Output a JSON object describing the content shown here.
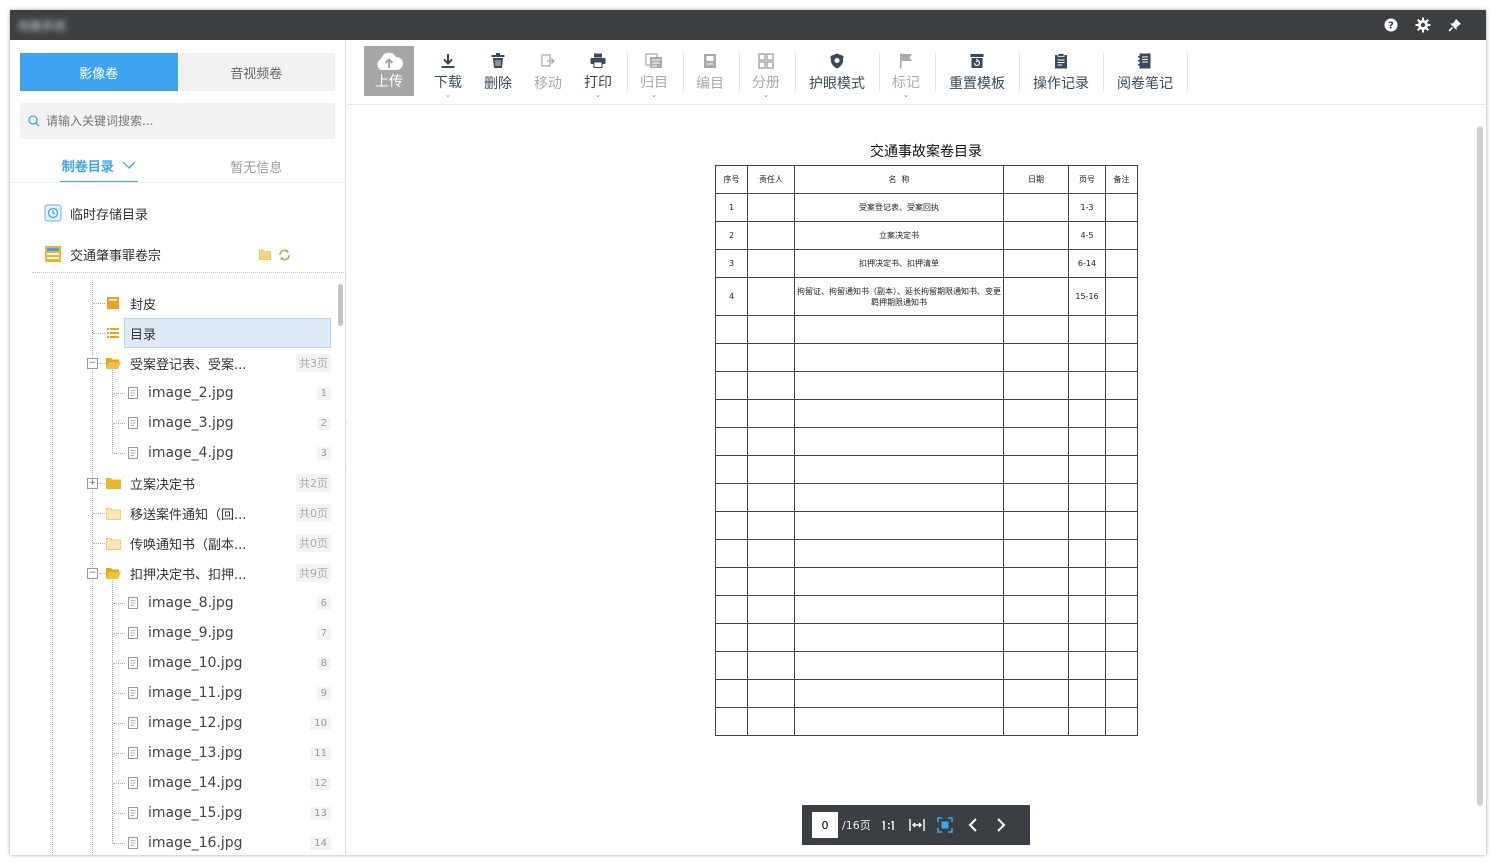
{
  "window": {
    "title": "档案系统"
  },
  "sidebar": {
    "tabs": [
      {
        "label": "影像卷"
      },
      {
        "label": "音视频卷"
      }
    ],
    "search": {
      "placeholder": "请输入关键词搜索..."
    },
    "subtabs": [
      {
        "label": "制卷目录"
      },
      {
        "label": "暂无信息"
      }
    ],
    "root_items": [
      {
        "label": "临时存储目录"
      },
      {
        "label": "交通肇事罪卷宗"
      }
    ],
    "tree": [
      {
        "label": "封皮"
      },
      {
        "label": "目录"
      },
      {
        "label": "受案登记表、受案...",
        "count": "共3页"
      },
      {
        "label": "image_2.jpg",
        "num": "1"
      },
      {
        "label": "image_3.jpg",
        "num": "2"
      },
      {
        "label": "image_4.jpg",
        "num": "3"
      },
      {
        "label": "立案决定书",
        "count": "共2页"
      },
      {
        "label": "移送案件通知（回...",
        "count": "共0页"
      },
      {
        "label": "传唤通知书（副本...",
        "count": "共0页"
      },
      {
        "label": "扣押决定书、扣押...",
        "count": "共9页"
      },
      {
        "label": "image_8.jpg",
        "num": "6"
      },
      {
        "label": "image_9.jpg",
        "num": "7"
      },
      {
        "label": "image_10.jpg",
        "num": "8"
      },
      {
        "label": "image_11.jpg",
        "num": "9"
      },
      {
        "label": "image_12.jpg",
        "num": "10"
      },
      {
        "label": "image_13.jpg",
        "num": "11"
      },
      {
        "label": "image_14.jpg",
        "num": "12"
      },
      {
        "label": "image_15.jpg",
        "num": "13"
      },
      {
        "label": "image_16.jpg",
        "num": "14"
      }
    ]
  },
  "toolbar": {
    "upload": "上传",
    "download": "下载",
    "delete": "删除",
    "move": "移动",
    "print": "打印",
    "archive": "归目",
    "catalog": "编目",
    "split": "分册",
    "eye_mode": "护眼模式",
    "mark": "标记",
    "reset_template": "重置模板",
    "op_log": "操作记录",
    "notes": "阅卷笔记"
  },
  "document": {
    "title": "交通事故案卷目录",
    "headers": [
      "序号",
      "责任人",
      "名  称",
      "日期",
      "页号",
      "备注"
    ],
    "rows": [
      {
        "no": "1",
        "name": "受案登记表、受案回执",
        "pages": "1-3"
      },
      {
        "no": "2",
        "name": "立案决定书",
        "pages": "4-5"
      },
      {
        "no": "3",
        "name": "扣押决定书、扣押清单",
        "pages": "6-14"
      },
      {
        "no": "4",
        "name": "拘留证、拘留通知书（副本）、延长拘留期限通知书、变更羁押期限通知书",
        "pages": "15-16"
      }
    ]
  },
  "pager": {
    "current": "0",
    "total": "/16页"
  },
  "colors": {
    "accent": "#3ea4f2",
    "titlebar": "#3c4043",
    "pager": "#3b3e42",
    "folder": "#f0b429"
  }
}
